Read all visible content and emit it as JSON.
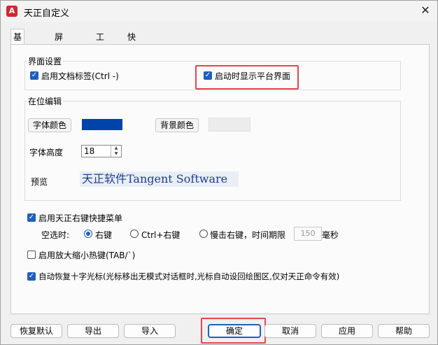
{
  "window": {
    "title": "天正自定义",
    "app_icon_letter": "A",
    "close_glyph": "✕"
  },
  "tabs": [
    {
      "label": "基本设置",
      "active": true
    },
    {
      "label": "屏幕菜单",
      "active": false
    },
    {
      "label": "工具条",
      "active": false
    },
    {
      "label": "快捷键",
      "active": false
    }
  ],
  "interface_settings": {
    "title": "界面设置",
    "doc_tabs": {
      "label": "启用文档标签(Ctrl -)",
      "checked": true
    },
    "show_platform": {
      "label": "启动时显示平台界面",
      "checked": true
    }
  },
  "inplace_edit": {
    "title": "在位编辑",
    "font_color_button": "字体颜色",
    "font_color": "#0044a8",
    "bg_color_button": "背景颜色",
    "bg_color": "#f0f0f0",
    "font_height_label": "字体高度",
    "font_height_value": "18",
    "preview_label": "预览",
    "preview_text": "天正软件Tangent Software"
  },
  "right_click": {
    "label": "启用天正右键快捷菜单",
    "checked": true,
    "empty_select_label": "空选时:",
    "options": [
      {
        "label": "右键",
        "selected": true
      },
      {
        "label": "Ctrl+右键",
        "selected": false
      },
      {
        "label": "慢击右键，时间期限",
        "selected": false
      }
    ],
    "time_value": "150",
    "time_unit": "毫秒"
  },
  "zoom_hotkey": {
    "label": "启用放大缩小热键(TAB/`)",
    "checked": false
  },
  "auto_cursor": {
    "label": "自动恢复十字光标(光标移出无模式对话框时,光标自动设回绘图区,仅对天正命令有效)",
    "checked": true
  },
  "buttons": {
    "restore_default": "恢复默认",
    "export": "导出",
    "import": "导入",
    "ok": "确定",
    "cancel": "取消",
    "apply": "应用",
    "help": "帮助"
  },
  "colors": {
    "accent": "#1f5fbf",
    "highlight": "#e2474f"
  }
}
